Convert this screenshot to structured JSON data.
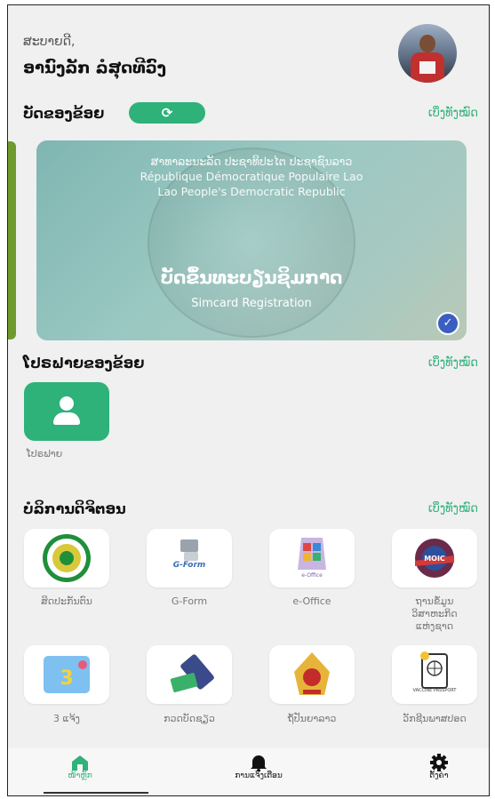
{
  "header": {
    "greeting": "ສະບາຍດີ,",
    "user_name": "ອານົງລັກ ລໍສຸດທີວົງ"
  },
  "my_cards": {
    "title": "ບັດຂອງຂ້ອຍ",
    "see_all": "ເບິ່ງທັງໝົດ",
    "refresh_icon": "⟳",
    "card": {
      "line1": "ສາທາລະນະລັດ ປະຊາທິປະໄຕ ປະຊາຊົນລາວ",
      "line2": "République Démocratique Populaire Lao",
      "line3": "Lao People's Democratic Republic",
      "title": "ບັດຂຶ້ນທະບຽນຊິມກາດ",
      "subtitle": "Simcard Registration",
      "check_icon": "✓"
    }
  },
  "my_profiles": {
    "title": "ໂປຣຟາຍຂອງຂ້ອຍ",
    "see_all": "ເບິ່ງທັງໝົດ",
    "items": [
      {
        "label": "ໂປຣຟາຍ"
      }
    ]
  },
  "digital_services": {
    "title": "ບໍລິການດິຈິຕອນ",
    "see_all": "ເບິ່ງທັງໝົດ",
    "items": [
      {
        "label": "ສິດປະກັນຕົນ"
      },
      {
        "label": "G-Form",
        "logo_text": "G-Form"
      },
      {
        "label": "e-Office",
        "logo_text": "e-Office"
      },
      {
        "label": "ຖານຂໍ້ມູນ\nວິສາຫະກິດ\nແຫ່ງຊາດ",
        "logo_text": "MOIC"
      },
      {
        "label": "3 ແຈ້ງ"
      },
      {
        "label": "ກວດບັດຊຽວ"
      },
      {
        "label": "ຖ້ໍປັນຍາລາວ"
      },
      {
        "label": "ວັກຊີນພາສປອດ",
        "logo_text": "VACCINE PASSPORT"
      }
    ]
  },
  "bottom_nav": {
    "home": "ໜ້າຫຼັກ",
    "notifications": "ການແຈ້ງເຕືອນ",
    "settings": "ຕັ້ງຄ່າ"
  }
}
